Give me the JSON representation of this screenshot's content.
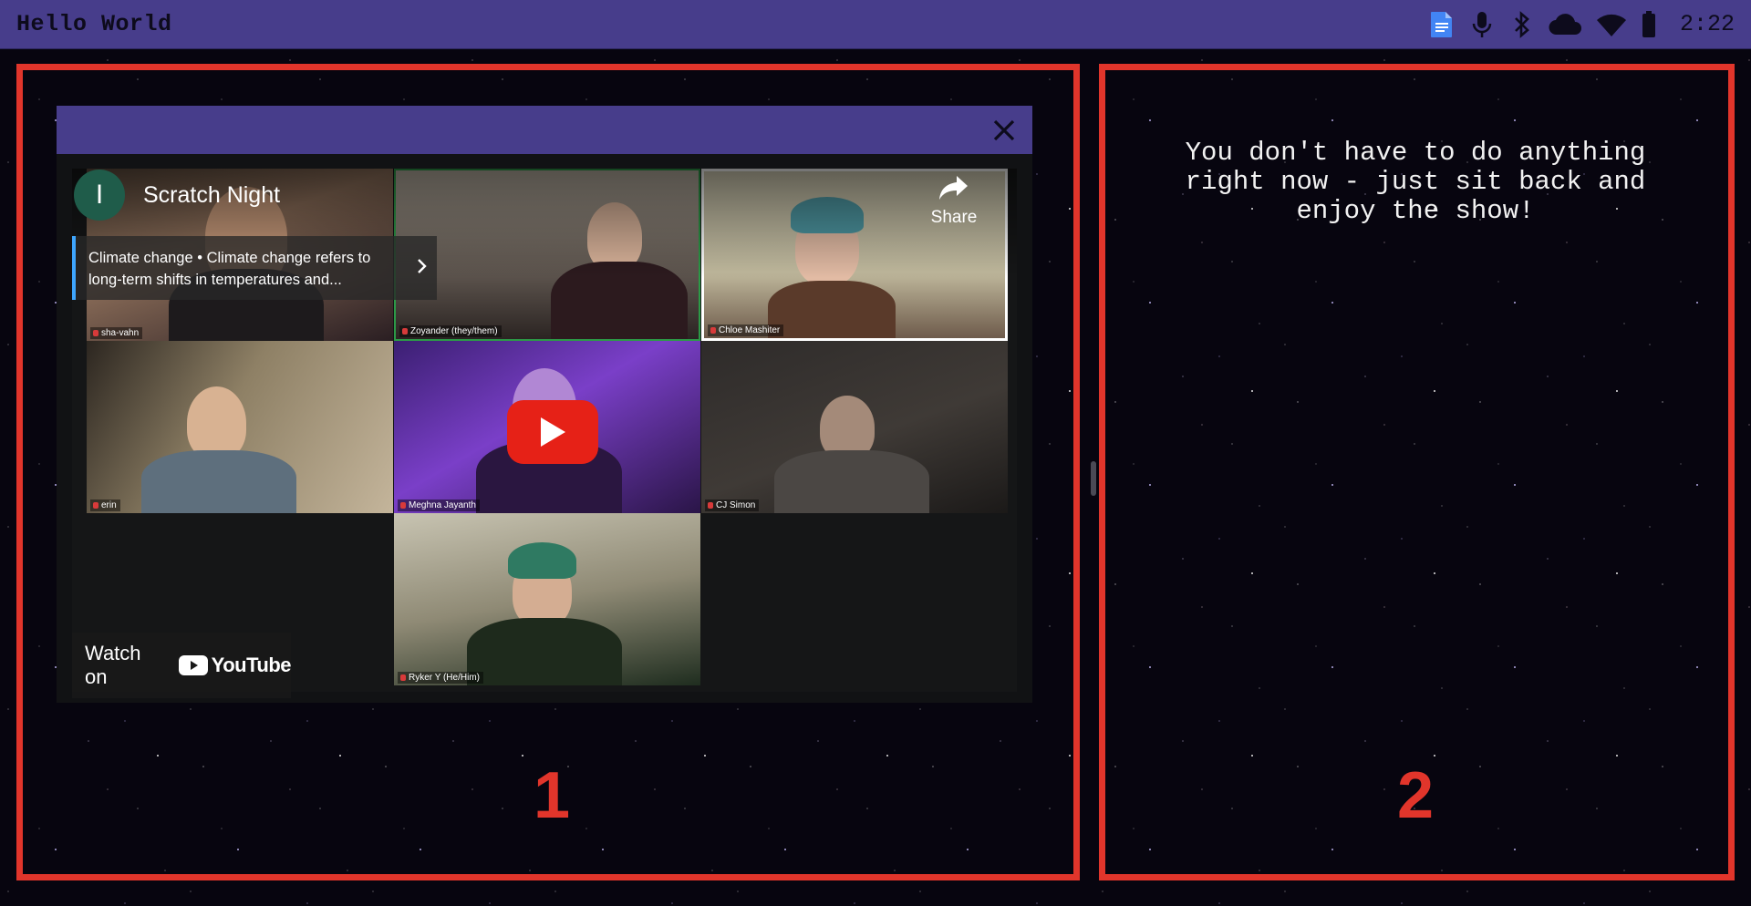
{
  "topbar": {
    "title": "Hello World",
    "clock": "2:22",
    "tray_icons": [
      "docs-icon",
      "mic-icon",
      "bluetooth-icon",
      "cloud-icon",
      "wifi-icon",
      "battery-icon"
    ],
    "color": "#473d8b"
  },
  "panel1": {
    "number": "1"
  },
  "panel2": {
    "number": "2",
    "instructions": "You don't have to do anything right now - just sit back and enjoy the show!"
  },
  "popup": {
    "close_label": "✕",
    "video": {
      "channel_initial": "I",
      "title": "Scratch Night",
      "share_label": "Share",
      "topic_card": "Climate change • Climate change refers to long-term shifts in temperatures and...",
      "watch_on_label": "Watch on",
      "youtube_label": "YouTube",
      "participants": [
        "sha-vahn",
        "Zoyander (they/them)",
        "Chloe Mashiter",
        "erin",
        "Meghna Jayanth",
        "CJ Simon",
        "Ryker Y (He/Him)"
      ]
    }
  },
  "colors": {
    "frame": "#e1352b",
    "accent": "#473d8b",
    "youtube_red": "#e62117"
  }
}
